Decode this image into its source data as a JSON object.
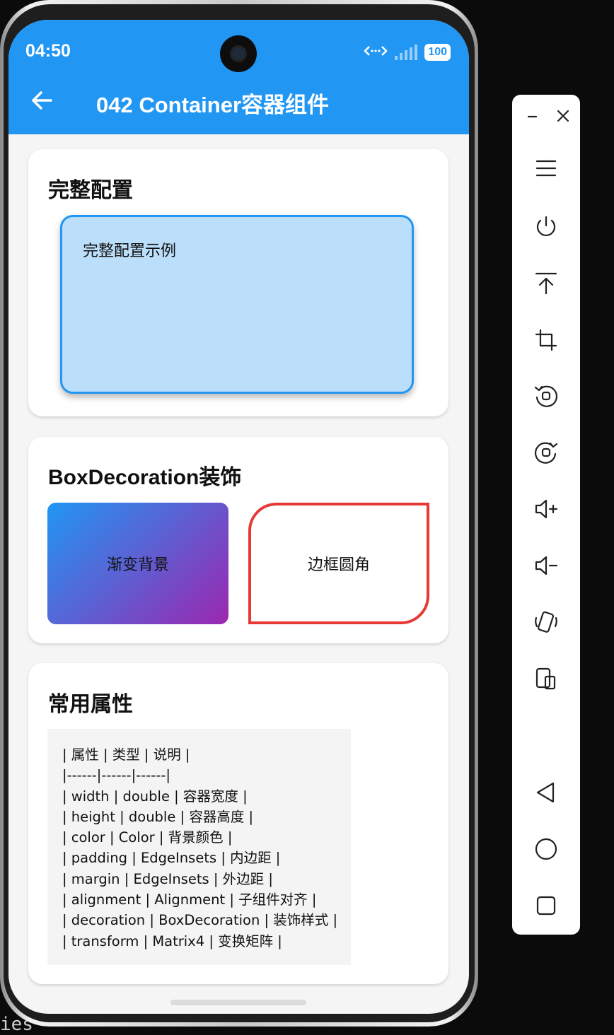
{
  "background": {
    "terminal_fragment": "ies"
  },
  "status_bar": {
    "time": "04:50",
    "battery": "100"
  },
  "app_bar": {
    "title": "042 Container容器组件",
    "color": "#2196f3"
  },
  "sections": {
    "full_config": {
      "title": "完整配置",
      "box_text": "完整配置示例"
    },
    "box_decoration": {
      "title": "BoxDecoration装饰",
      "gradient_text": "渐变背景",
      "border_text": "边框圆角"
    },
    "common_props": {
      "title": "常用属性",
      "lines": [
        "| 属性 | 类型 | 说明 |",
        "|------|------|------|",
        "| width | double | 容器宽度 |",
        "| height | double | 容器高度 |",
        "| color | Color | 背景颜色 |",
        "| padding | EdgeInsets | 内边距 |",
        "| margin | EdgeInsets | 外边距 |",
        "| alignment | Alignment | 子组件对齐 |",
        "| decoration | BoxDecoration | 装饰样式 |",
        "| transform | Matrix4 | 变换矩阵 |"
      ]
    }
  },
  "emulator_toolbar": {
    "buttons": [
      "minimize-icon",
      "close-icon",
      "menu-icon",
      "power-icon",
      "top-icon",
      "crop-icon",
      "rotate-left-icon",
      "rotate-right-icon",
      "volume-up-icon",
      "volume-down-icon",
      "shake-icon",
      "fold-icon",
      "back-icon",
      "home-icon",
      "overview-icon"
    ]
  }
}
